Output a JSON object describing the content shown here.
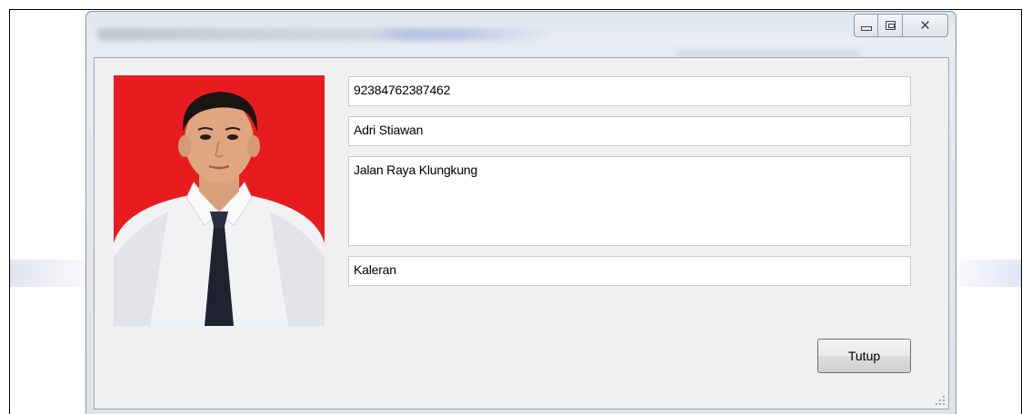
{
  "window": {
    "buttons": {
      "minimize_icon": "minimize-icon",
      "maximize_icon": "maximize-icon",
      "close_icon": "close-icon"
    }
  },
  "form": {
    "id_value": "92384762387462",
    "name_value": "Adri Stiawan",
    "address_value": "Jalan Raya Klungkung",
    "village_value": "Kaleran",
    "close_button_label": "Tutup"
  },
  "colors": {
    "photo_background": "#e81c1e"
  }
}
